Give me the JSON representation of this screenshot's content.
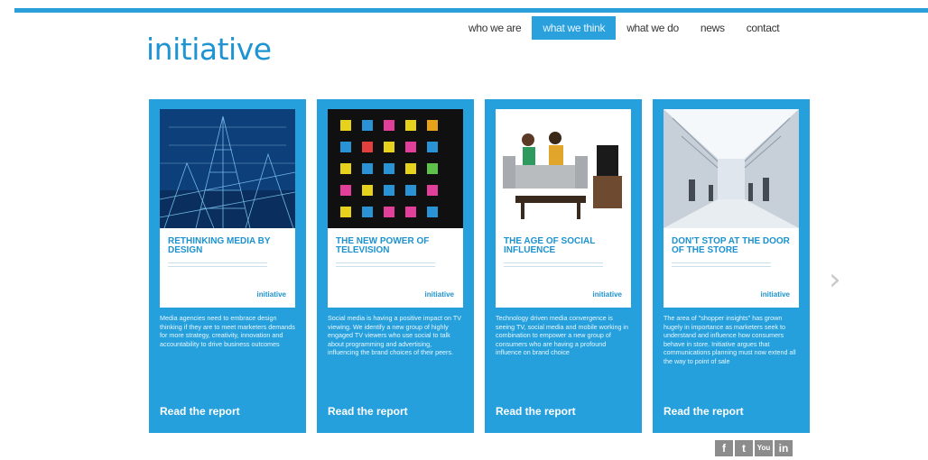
{
  "brand": {
    "logo": "initiative"
  },
  "nav": {
    "items": [
      {
        "label": "who we are",
        "active": false
      },
      {
        "label": "what we think",
        "active": true
      },
      {
        "label": "what we do",
        "active": false
      },
      {
        "label": "news",
        "active": false
      },
      {
        "label": "contact",
        "active": false
      }
    ]
  },
  "reports": [
    {
      "cover_title": "RETHINKING MEDIA BY DESIGN",
      "cover_brand": "initiative",
      "description": "Media agencies need to embrace design thinking if they are to meet marketers demands for more strategy, creativity, innovation and accountability to drive business outcomes",
      "cta": "Read the report",
      "art": "blueprint-skyscraper"
    },
    {
      "cover_title": "THE NEW POWER OF TELEVISION",
      "cover_brand": "initiative",
      "description": "Social media is having a positive impact on TV viewing. We identify a new group of highly engaged TV viewers who use social to talk about programming and advertising, influencing the brand choices of their peers.",
      "cta": "Read the report",
      "art": "social-icons-grid"
    },
    {
      "cover_title": "THE AGE OF SOCIAL INFLUENCE",
      "cover_brand": "initiative",
      "description": "Technology driven media convergence is seeing TV, social media and mobile working in combination to empower a new group of consumers who are having a profound influence on brand choice",
      "cta": "Read the report",
      "art": "couple-on-sofa"
    },
    {
      "cover_title": "DON'T STOP AT THE DOOR OF THE STORE",
      "cover_brand": "initiative",
      "description": "The area of \"shopper insights\" has grown hugely in importance as marketers seek to understand and influence how consumers behave in store. Initiative argues that communications planning must now extend all the way to point of sale",
      "cta": "Read the report",
      "art": "shopping-mall"
    }
  ],
  "carousel": {
    "next_icon": "chevron-right-icon"
  },
  "social": [
    {
      "name": "facebook-icon",
      "glyph": "f"
    },
    {
      "name": "twitter-icon",
      "glyph": "t"
    },
    {
      "name": "youtube-icon",
      "glyph": "You"
    },
    {
      "name": "linkedin-icon",
      "glyph": "in"
    }
  ],
  "colors": {
    "accent": "#2aa0dc",
    "card": "#25a0dd",
    "text": "#333333"
  }
}
